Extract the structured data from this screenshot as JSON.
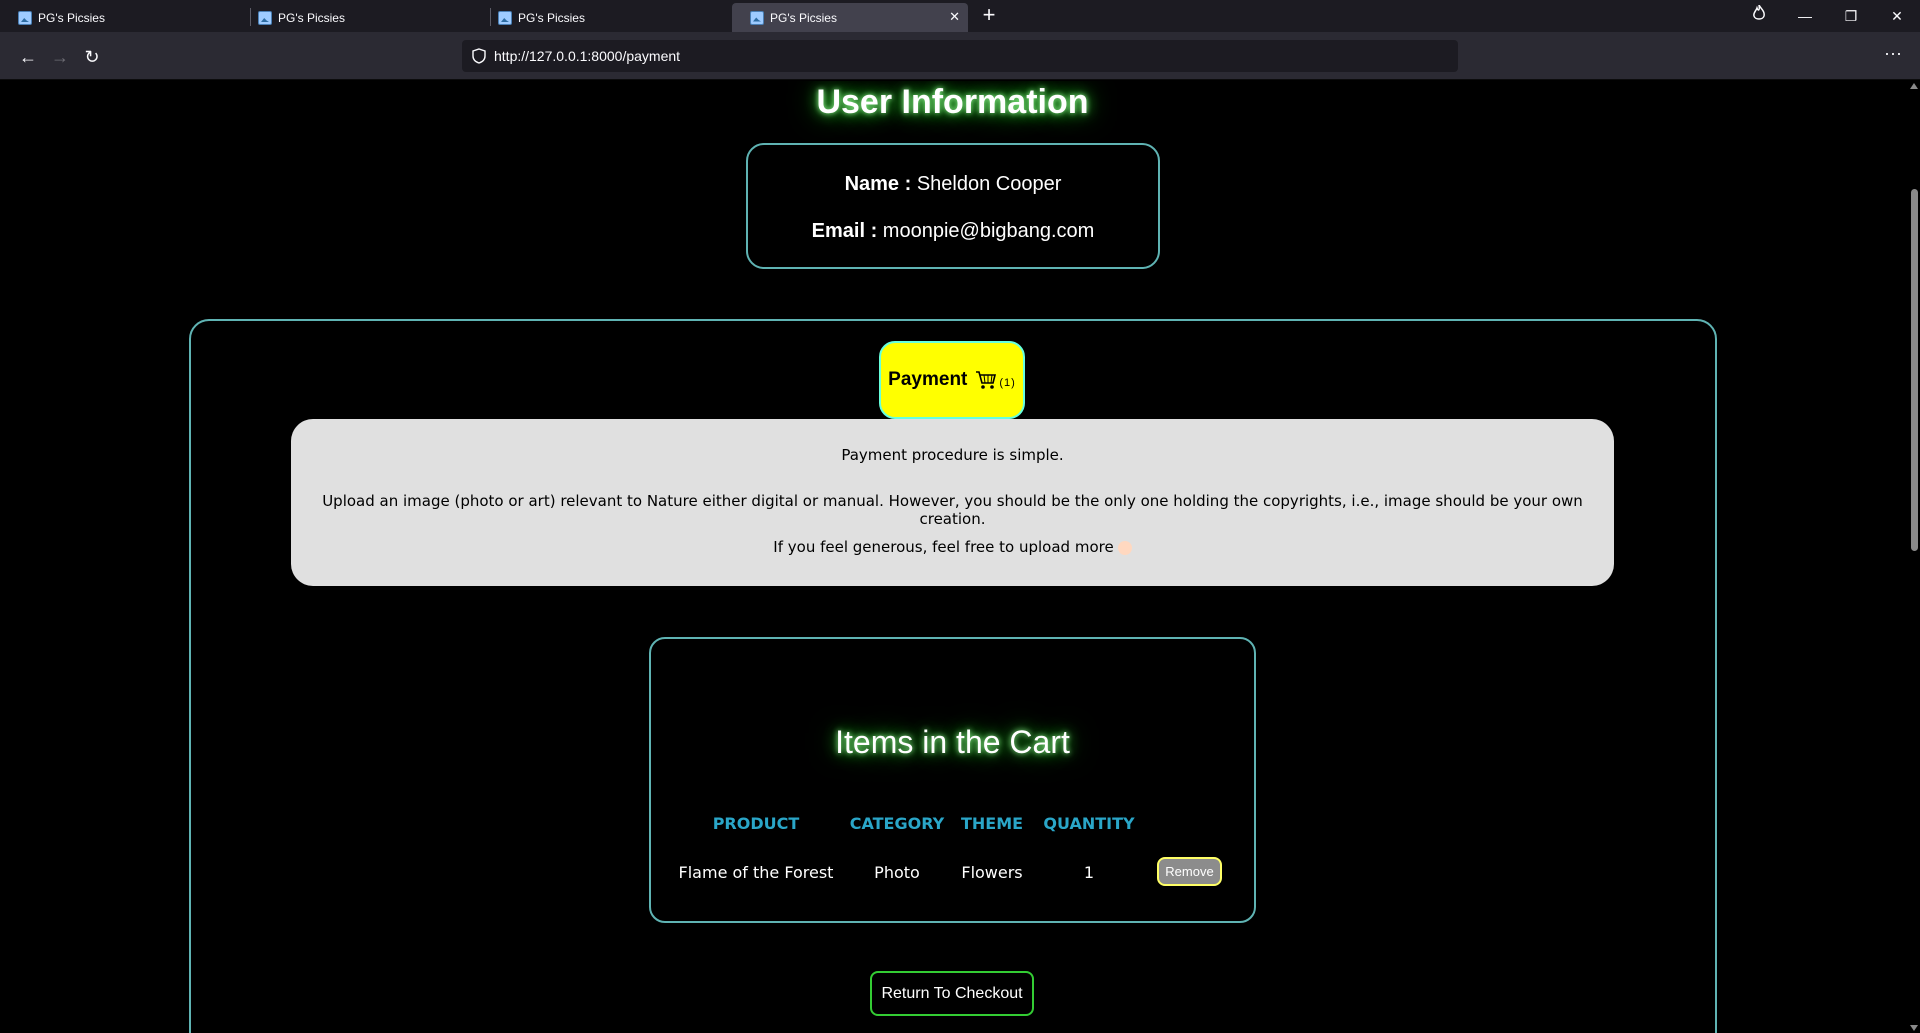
{
  "browser": {
    "tabs": [
      {
        "title": "PG's Picsies"
      },
      {
        "title": "PG's Picsies"
      },
      {
        "title": "PG's Picsies"
      },
      {
        "title": "PG's Picsies"
      }
    ],
    "url": "http://127.0.0.1:8000/payment"
  },
  "user_info": {
    "title": "User Information",
    "name_label": "Name :",
    "name_value": "Sheldon Cooper",
    "email_label": "Email :",
    "email_value": "moonpie@bigbang.com"
  },
  "payment": {
    "button_label": "Payment",
    "cart_count": "(1)",
    "line1": "Payment procedure is simple.",
    "line2": "Upload an image (photo or art)  relevant to Nature either digital or manual. However, you should be the only one holding the copyrights, i.e., image should be your own creation.",
    "line3": "If you feel generous, feel free to upload more"
  },
  "cart": {
    "title": "Items in the Cart",
    "headers": [
      "PRODUCT",
      "CATEGORY",
      "THEME",
      "QUANTITY"
    ],
    "rows": [
      {
        "product": "Flame of the Forest",
        "category": "Photo",
        "theme": "Flowers",
        "quantity": "1",
        "action": "Remove"
      }
    ]
  },
  "return_label": "Return To Checkout"
}
